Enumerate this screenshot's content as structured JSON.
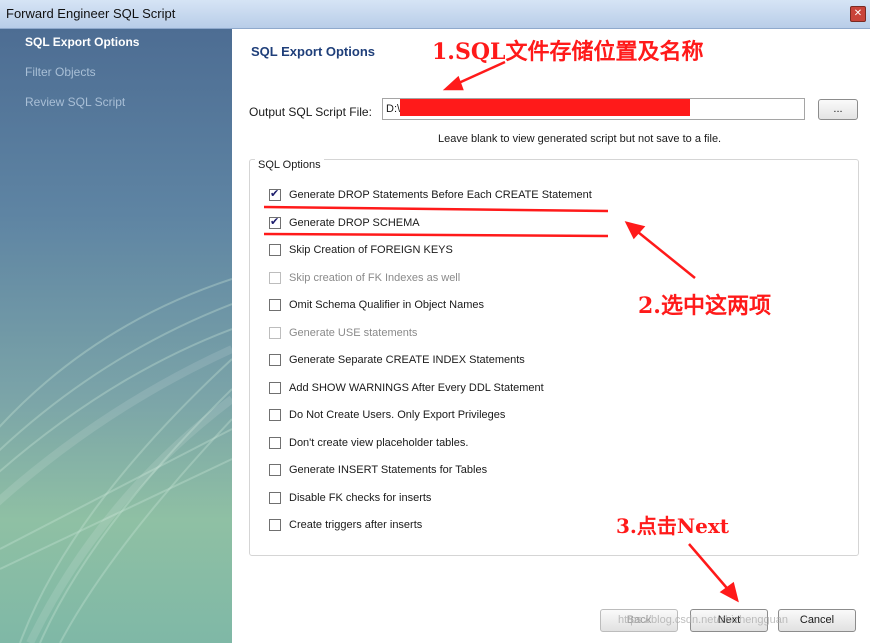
{
  "window": {
    "title": "Forward Engineer SQL Script"
  },
  "sidebar": {
    "items": [
      {
        "label": "SQL Export Options",
        "active": true
      },
      {
        "label": "Filter Objects",
        "active": false
      },
      {
        "label": "Review SQL Script",
        "active": false
      }
    ]
  },
  "main": {
    "heading": "SQL Export Options",
    "output_label": "Output SQL Script File:",
    "output_value": "D:\\",
    "browse_label": "...",
    "hint": "Leave blank to view generated script but not save to a file.",
    "group_label": "SQL Options",
    "options": [
      {
        "label": "Generate DROP Statements Before Each CREATE Statement",
        "checked": true,
        "enabled": true
      },
      {
        "label": "Generate DROP SCHEMA",
        "checked": true,
        "enabled": true
      },
      {
        "label": "Skip Creation of FOREIGN KEYS",
        "checked": false,
        "enabled": true
      },
      {
        "label": "Skip creation of FK Indexes as well",
        "checked": false,
        "enabled": false
      },
      {
        "label": "Omit Schema Qualifier in Object Names",
        "checked": false,
        "enabled": true
      },
      {
        "label": "Generate USE statements",
        "checked": false,
        "enabled": false
      },
      {
        "label": "Generate Separate CREATE INDEX Statements",
        "checked": false,
        "enabled": true
      },
      {
        "label": "Add SHOW WARNINGS After Every DDL Statement",
        "checked": false,
        "enabled": true
      },
      {
        "label": "Do Not Create Users. Only Export Privileges",
        "checked": false,
        "enabled": true
      },
      {
        "label": "Don't create view placeholder tables.",
        "checked": false,
        "enabled": true
      },
      {
        "label": "Generate INSERT Statements for Tables",
        "checked": false,
        "enabled": true
      },
      {
        "label": "Disable FK checks for inserts",
        "checked": false,
        "enabled": true
      },
      {
        "label": "Create triggers after inserts",
        "checked": false,
        "enabled": true
      }
    ]
  },
  "buttons": {
    "back": "Back",
    "next": "Next",
    "cancel": "Cancel"
  },
  "annotations": {
    "a1": "1.SQL文件存储位置及名称",
    "a2": "2.选中这两项",
    "a3": "3.点击Next",
    "color": "#ff1a1a"
  },
  "watermark": "https://blog.csdn.net/zhizhengguan"
}
